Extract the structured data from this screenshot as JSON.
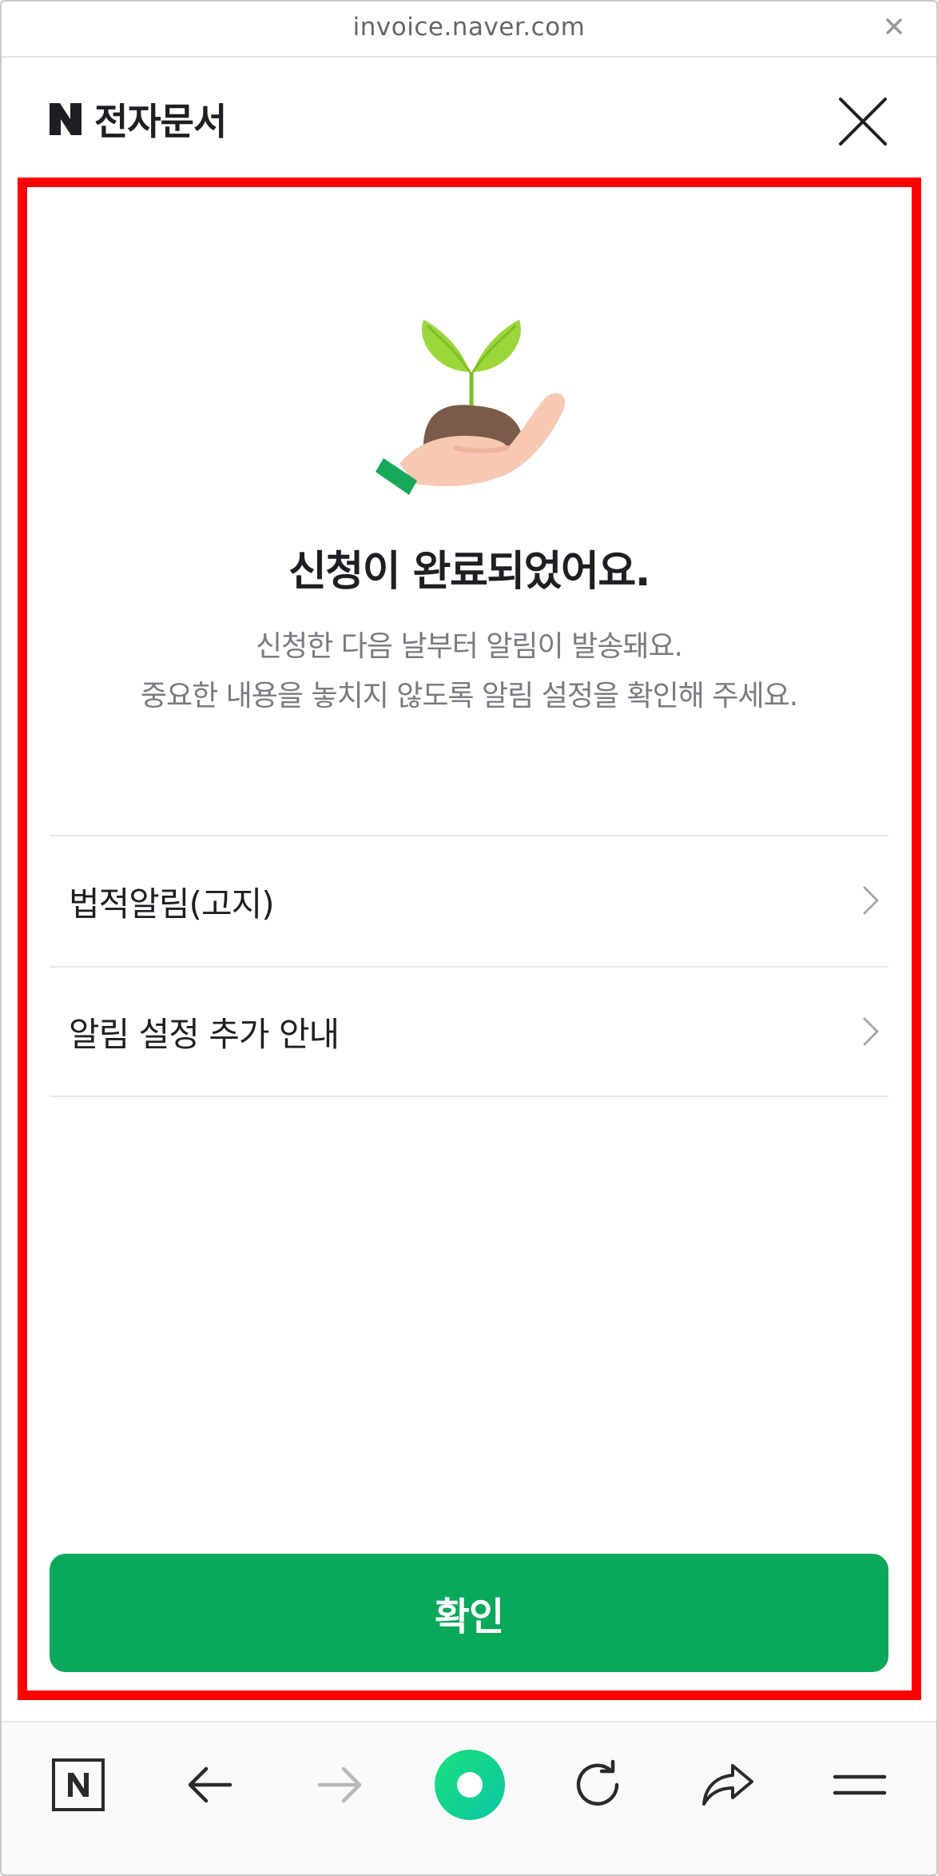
{
  "browser": {
    "url": "invoice.naver.com",
    "close_glyph": "×"
  },
  "header": {
    "logo_letter": "N",
    "title": "전자문서"
  },
  "main": {
    "illustration": "seedling-in-hand-icon",
    "headline": "신청이 완료되었어요.",
    "description": [
      "신청한 다음 날부터 알림이 발송돼요.",
      "중요한 내용을 놓치지 않도록 알림 설정을 확인해 주세요."
    ],
    "list_items": [
      {
        "label": "법적알림(고지)"
      },
      {
        "label": "알림 설정 추가 안내"
      }
    ],
    "confirm_label": "확인"
  },
  "toolbar": {
    "items": [
      "naver-home-icon",
      "back-arrow-icon",
      "forward-arrow-icon",
      "green-dot-icon",
      "reload-icon",
      "share-icon",
      "menu-icon"
    ]
  },
  "colors": {
    "accent": "#0aa85a",
    "highlight": "#ff0000",
    "text": "#1e1e23",
    "subtext": "#7a7a80"
  }
}
